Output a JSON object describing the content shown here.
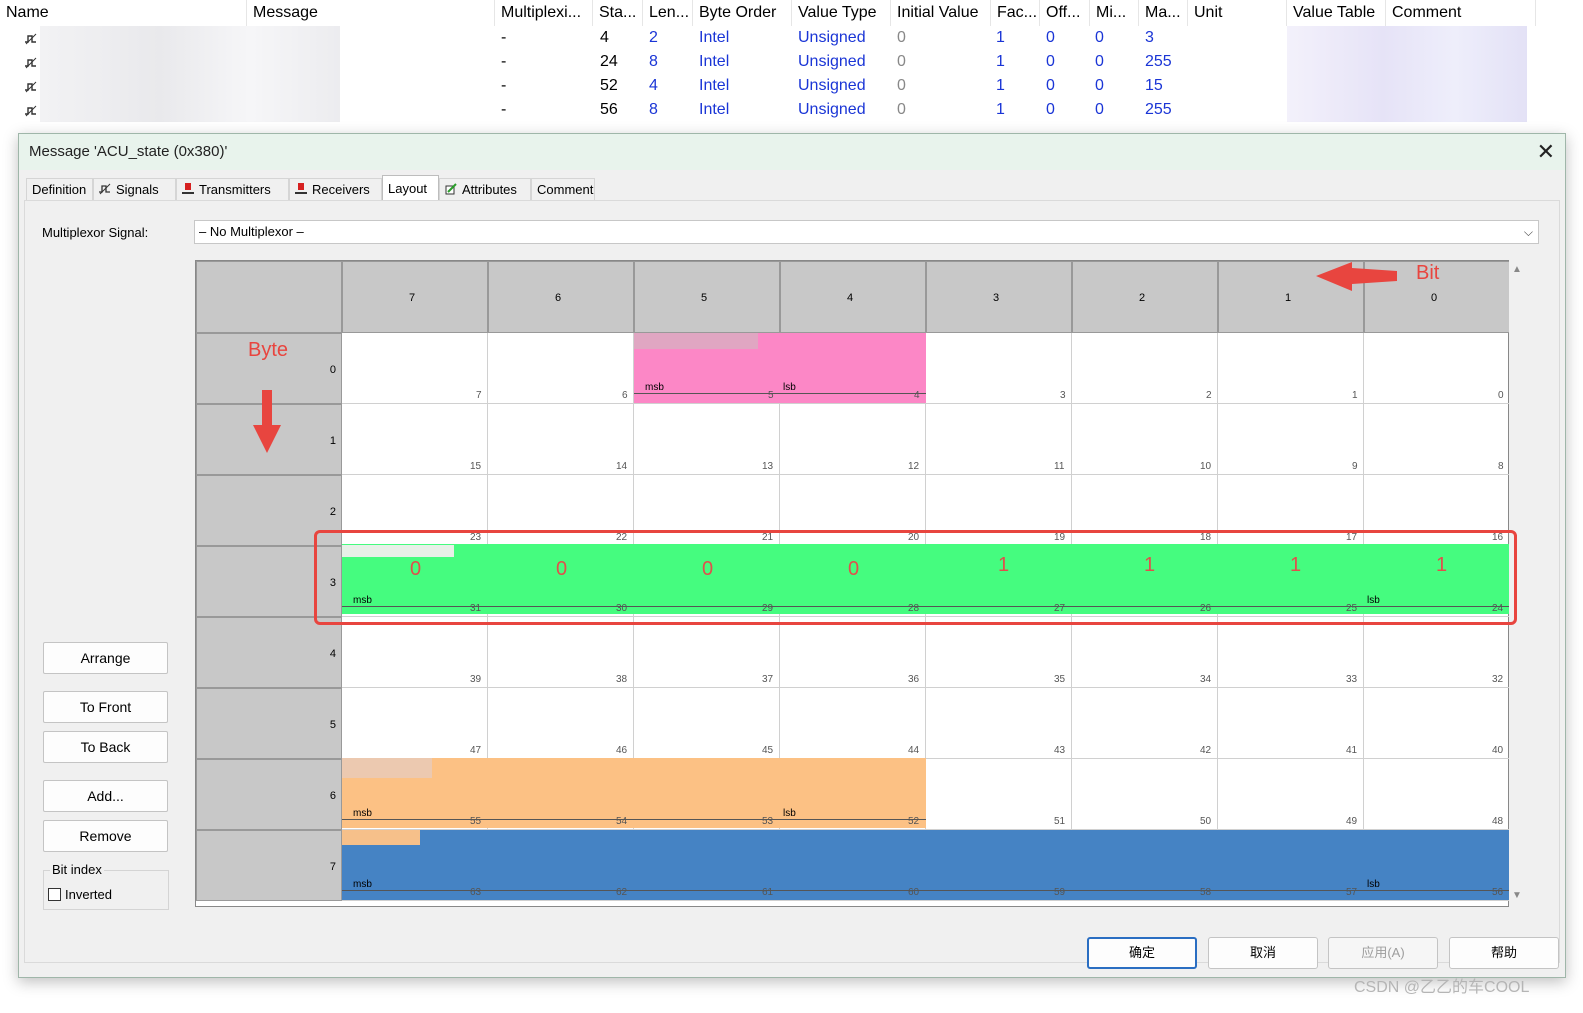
{
  "signal_table": {
    "headers": [
      "Name",
      "Message",
      "Multiplexi...",
      "Sta...",
      "Len...",
      "Byte Order",
      "Value Type",
      "Initial Value",
      "Fac...",
      "Off...",
      "Mi...",
      "Ma...",
      "Unit",
      "Value Table",
      "Comment"
    ],
    "rows": [
      {
        "multiplexing": "-",
        "start": "4",
        "length": "2",
        "byte_order": "Intel",
        "value_type": "Unsigned",
        "initial": "0",
        "factor": "1",
        "offset": "0",
        "min": "0",
        "max": "3"
      },
      {
        "multiplexing": "-",
        "start": "24",
        "length": "8",
        "byte_order": "Intel",
        "value_type": "Unsigned",
        "initial": "0",
        "factor": "1",
        "offset": "0",
        "min": "0",
        "max": "255"
      },
      {
        "multiplexing": "-",
        "start": "52",
        "length": "4",
        "byte_order": "Intel",
        "value_type": "Unsigned",
        "initial": "0",
        "factor": "1",
        "offset": "0",
        "min": "0",
        "max": "15"
      },
      {
        "multiplexing": "-",
        "start": "56",
        "length": "8",
        "byte_order": "Intel",
        "value_type": "Unsigned",
        "initial": "0",
        "factor": "1",
        "offset": "0",
        "min": "0",
        "max": "255"
      }
    ]
  },
  "dialog": {
    "title": "Message 'ACU_state (0x380)'",
    "close_glyph": "✕",
    "tabs": [
      {
        "label": "Definition",
        "icon": "none"
      },
      {
        "label": "Signals",
        "icon": "signal-icon"
      },
      {
        "label": "Transmitters",
        "icon": "transmitter-icon"
      },
      {
        "label": "Receivers",
        "icon": "receiver-icon"
      },
      {
        "label": "Layout",
        "icon": "none",
        "active": true
      },
      {
        "label": "Attributes",
        "icon": "attributes-icon"
      },
      {
        "label": "Comment",
        "icon": "none"
      }
    ],
    "multiplexor_label": "Multiplexor Signal:",
    "multiplexor_value": "– No Multiplexor –",
    "side_buttons": {
      "arrange": "Arrange",
      "to_front": "To Front",
      "to_back": "To Back",
      "add": "Add...",
      "remove": "Remove"
    },
    "bit_index_label": "Bit index",
    "inverted_label": "Inverted",
    "inverted_checked": false,
    "bottom_buttons": {
      "ok": "确定",
      "cancel": "取消",
      "apply": "应用(A)",
      "help": "帮助"
    }
  },
  "layout_grid": {
    "bit_headers": [
      "7",
      "6",
      "5",
      "4",
      "3",
      "2",
      "1",
      "0"
    ],
    "byte_labels": [
      "0",
      "1",
      "2",
      "3",
      "4",
      "5",
      "6",
      "7"
    ],
    "msb_text": "msb",
    "lsb_text": "lsb",
    "signal_colors": {
      "signal_byte0": "#fc87c6",
      "signal_byte3": "#45fc7f",
      "signal_byte6": "#fcc184",
      "signal_byte7": "#4583c4"
    },
    "byte3_bit_values": [
      "0",
      "0",
      "0",
      "0",
      "1",
      "1",
      "1",
      "1"
    ]
  },
  "annotations": {
    "bit_label": "Bit",
    "byte_label": "Byte",
    "color": "#e8453f"
  },
  "watermark": "CSDN @乙乙的车COOL"
}
